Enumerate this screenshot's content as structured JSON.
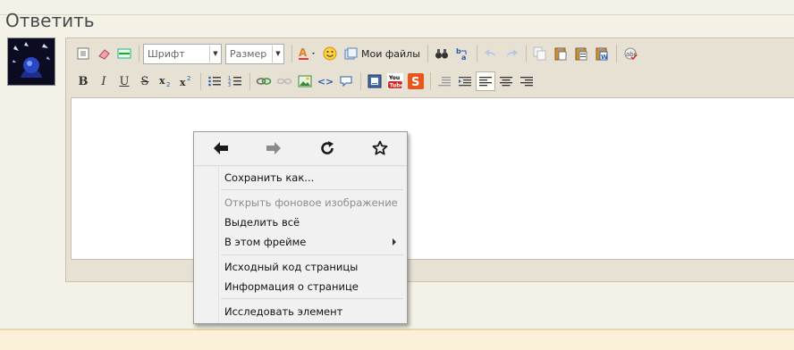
{
  "reply": {
    "title": "Ответить"
  },
  "toolbar": {
    "font_combo": "Шрифт",
    "size_combo": "Размер",
    "my_files": "Мои файлы"
  },
  "context_menu": {
    "items": [
      {
        "label": "Сохранить как...",
        "enabled": true
      },
      {
        "label": "Открыть фоновое изображение",
        "enabled": false
      },
      {
        "label": "Выделить всё",
        "enabled": true
      },
      {
        "label": "В этом фрейме",
        "enabled": true,
        "submenu": true
      },
      {
        "label": "Исходный код страницы",
        "enabled": true
      },
      {
        "label": "Информация о странице",
        "enabled": true
      },
      {
        "label": "Исследовать элемент",
        "enabled": true
      }
    ]
  },
  "colors": {
    "panel_bg": "#f4f1e6",
    "toolbar_bg": "#e6e1d3",
    "bottom_strip": "#fbf1d9",
    "menu_bg": "#f1f1f1"
  },
  "icons": [
    "back-icon",
    "forward-icon",
    "reload-icon",
    "bookmark-star-icon"
  ]
}
